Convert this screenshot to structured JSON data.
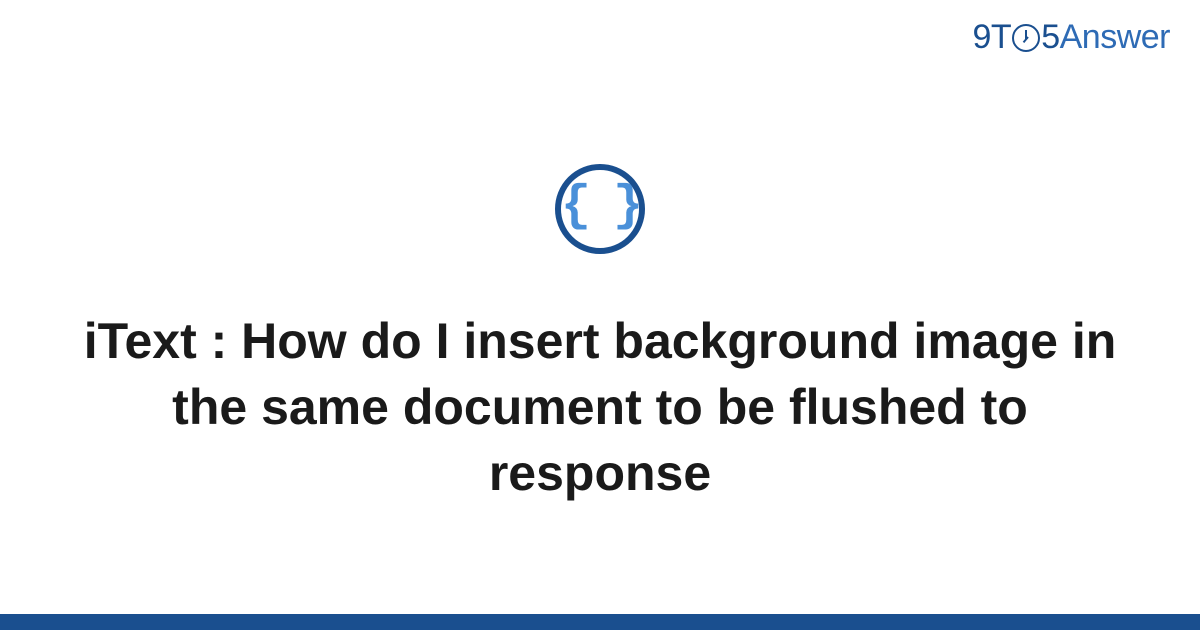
{
  "header": {
    "logo_prefix": "9T",
    "logo_number": "5",
    "logo_suffix": "Answer"
  },
  "content": {
    "icon_name": "braces-icon",
    "icon_content": "{ }",
    "title": "iText : How do I insert background image in the same document to be flushed to response"
  },
  "colors": {
    "primary": "#1a4f8f",
    "accent": "#4a90d9",
    "text": "#1a1a1a"
  }
}
